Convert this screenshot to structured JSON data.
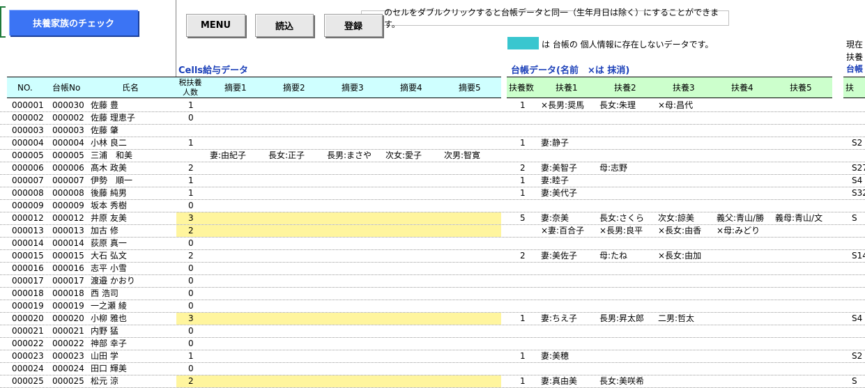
{
  "toolbar": {
    "check_label": "扶養家族のチェック",
    "menu_label": "MENU",
    "load_label": "読込",
    "register_label": "登録"
  },
  "note_text": "のセルをダブルクリックすると台帳データと同一（生年月日は除く）にすることができます。",
  "legend_text": "は 台帳の 個人情報に存在しないデータです。",
  "right_cut": {
    "line1": "現在",
    "line2": "扶養",
    "title": "台帳"
  },
  "sections": {
    "cells": "Cells給与データ",
    "ledger": "台帳データ(名前　×は 抹消)"
  },
  "headers": {
    "no": "NO.",
    "ledger_no": "台帳No",
    "name": "氏名",
    "tax_dep_1": "税扶養",
    "tax_dep_2": "人数",
    "summary": [
      "摘要1",
      "摘要2",
      "摘要3",
      "摘要4",
      "摘要5"
    ],
    "dep_count": "扶養数",
    "deps": [
      "扶養1",
      "扶養2",
      "扶養3",
      "扶養4",
      "扶養5"
    ],
    "right_cut": "扶"
  },
  "colors": {
    "cells_header": "#cfffff",
    "ledger_header": "#ccffcc",
    "highlight": "#fff59e",
    "legend": "#39c6cf",
    "title": "#1a3fb8",
    "button": "#3b74f4"
  },
  "rows": [
    {
      "no": "000001",
      "ledger": "000030",
      "name": "佐藤 豊",
      "tax": "1",
      "summary": [
        "",
        "",
        "",
        "",
        ""
      ],
      "dep_count": "1",
      "deps": [
        "×長男:奨馬",
        "長女:朱理",
        "×母:昌代",
        "",
        ""
      ],
      "right": "",
      "highlight": false
    },
    {
      "no": "000002",
      "ledger": "000002",
      "name": "佐藤 理恵子",
      "tax": "0",
      "summary": [
        "",
        "",
        "",
        "",
        ""
      ],
      "dep_count": "",
      "deps": [
        "",
        "",
        "",
        "",
        ""
      ],
      "right": "",
      "highlight": false
    },
    {
      "no": "000003",
      "ledger": "000003",
      "name": "佐藤 肇",
      "tax": "",
      "summary": [
        "",
        "",
        "",
        "",
        ""
      ],
      "dep_count": "",
      "deps": [
        "",
        "",
        "",
        "",
        ""
      ],
      "right": "",
      "highlight": false
    },
    {
      "no": "000004",
      "ledger": "000004",
      "name": "小林 良二",
      "tax": "1",
      "summary": [
        "",
        "",
        "",
        "",
        ""
      ],
      "dep_count": "1",
      "deps": [
        "妻:静子",
        "",
        "",
        "",
        ""
      ],
      "right": "S2",
      "highlight": false
    },
    {
      "no": "000005",
      "ledger": "000005",
      "name": "三浦　和美",
      "tax": "",
      "summary": [
        "妻:由紀子",
        "長女:正子",
        "長男:まさや",
        "次女:愛子",
        "次男:智寛"
      ],
      "dep_count": "",
      "deps": [
        "",
        "",
        "",
        "",
        ""
      ],
      "right": "",
      "highlight": false
    },
    {
      "no": "000006",
      "ledger": "000006",
      "name": "髙木 政美",
      "tax": "2",
      "summary": [
        "",
        "",
        "",
        "",
        ""
      ],
      "dep_count": "2",
      "deps": [
        "妻:美智子",
        "母:志野",
        "",
        "",
        ""
      ],
      "right": "S27",
      "highlight": false
    },
    {
      "no": "000007",
      "ledger": "000007",
      "name": "伊勢　順一",
      "tax": "1",
      "summary": [
        "",
        "",
        "",
        "",
        ""
      ],
      "dep_count": "1",
      "deps": [
        "妻:睦子",
        "",
        "",
        "",
        ""
      ],
      "right": "S4",
      "highlight": false
    },
    {
      "no": "000008",
      "ledger": "000008",
      "name": "後藤 純男",
      "tax": "1",
      "summary": [
        "",
        "",
        "",
        "",
        ""
      ],
      "dep_count": "1",
      "deps": [
        "妻:美代子",
        "",
        "",
        "",
        ""
      ],
      "right": "S32",
      "highlight": false
    },
    {
      "no": "000009",
      "ledger": "000009",
      "name": "坂本 秀樹",
      "tax": "0",
      "summary": [
        "",
        "",
        "",
        "",
        ""
      ],
      "dep_count": "",
      "deps": [
        "",
        "",
        "",
        "",
        ""
      ],
      "right": "",
      "highlight": false
    },
    {
      "no": "000012",
      "ledger": "000012",
      "name": "井原 友美",
      "tax": "3",
      "summary": [
        "",
        "",
        "",
        "",
        ""
      ],
      "dep_count": "5",
      "deps": [
        "妻:奈美",
        "長女:さくら",
        "次女:諒美",
        "義父:青山/勝",
        "義母:青山/文"
      ],
      "right": "S",
      "highlight": true
    },
    {
      "no": "000013",
      "ledger": "000013",
      "name": "加古 修",
      "tax": "2",
      "summary": [
        "",
        "",
        "",
        "",
        ""
      ],
      "dep_count": "",
      "deps": [
        "×妻:百合子",
        "×長男:良平",
        "×長女:由香",
        "×母:みどり",
        ""
      ],
      "right": "",
      "highlight": true
    },
    {
      "no": "000014",
      "ledger": "000014",
      "name": "荻原 真一",
      "tax": "0",
      "summary": [
        "",
        "",
        "",
        "",
        ""
      ],
      "dep_count": "",
      "deps": [
        "",
        "",
        "",
        "",
        ""
      ],
      "right": "",
      "highlight": false
    },
    {
      "no": "000015",
      "ledger": "000015",
      "name": "大石 弘文",
      "tax": "2",
      "summary": [
        "",
        "",
        "",
        "",
        ""
      ],
      "dep_count": "2",
      "deps": [
        "妻:美佐子",
        "母:たね",
        "×長女:由加",
        "",
        ""
      ],
      "right": "S14",
      "highlight": false
    },
    {
      "no": "000016",
      "ledger": "000016",
      "name": "志平 小雪",
      "tax": "0",
      "summary": [
        "",
        "",
        "",
        "",
        ""
      ],
      "dep_count": "",
      "deps": [
        "",
        "",
        "",
        "",
        ""
      ],
      "right": "",
      "highlight": false
    },
    {
      "no": "000017",
      "ledger": "000017",
      "name": "渡邉 かおり",
      "tax": "0",
      "summary": [
        "",
        "",
        "",
        "",
        ""
      ],
      "dep_count": "",
      "deps": [
        "",
        "",
        "",
        "",
        ""
      ],
      "right": "",
      "highlight": false
    },
    {
      "no": "000018",
      "ledger": "000018",
      "name": "西 浩司",
      "tax": "0",
      "summary": [
        "",
        "",
        "",
        "",
        ""
      ],
      "dep_count": "",
      "deps": [
        "",
        "",
        "",
        "",
        ""
      ],
      "right": "",
      "highlight": false
    },
    {
      "no": "000019",
      "ledger": "000019",
      "name": "一之瀬 綾",
      "tax": "0",
      "summary": [
        "",
        "",
        "",
        "",
        ""
      ],
      "dep_count": "",
      "deps": [
        "",
        "",
        "",
        "",
        ""
      ],
      "right": "",
      "highlight": false
    },
    {
      "no": "000020",
      "ledger": "000020",
      "name": "小柳 雅也",
      "tax": "3",
      "summary": [
        "",
        "",
        "",
        "",
        ""
      ],
      "dep_count": "1",
      "deps": [
        "妻:ちえ子",
        "長男:昇太郎",
        "二男:哲太",
        "",
        ""
      ],
      "right": "S4",
      "highlight": true
    },
    {
      "no": "000021",
      "ledger": "000021",
      "name": "内野 猛",
      "tax": "0",
      "summary": [
        "",
        "",
        "",
        "",
        ""
      ],
      "dep_count": "",
      "deps": [
        "",
        "",
        "",
        "",
        ""
      ],
      "right": "",
      "highlight": false
    },
    {
      "no": "000022",
      "ledger": "000022",
      "name": "神部 幸子",
      "tax": "0",
      "summary": [
        "",
        "",
        "",
        "",
        ""
      ],
      "dep_count": "",
      "deps": [
        "",
        "",
        "",
        "",
        ""
      ],
      "right": "",
      "highlight": false
    },
    {
      "no": "000023",
      "ledger": "000023",
      "name": "山田 学",
      "tax": "1",
      "summary": [
        "",
        "",
        "",
        "",
        ""
      ],
      "dep_count": "1",
      "deps": [
        "妻:美穂",
        "",
        "",
        "",
        ""
      ],
      "right": "S2",
      "highlight": false
    },
    {
      "no": "000024",
      "ledger": "000024",
      "name": "田口 輝美",
      "tax": "0",
      "summary": [
        "",
        "",
        "",
        "",
        ""
      ],
      "dep_count": "",
      "deps": [
        "",
        "",
        "",
        "",
        ""
      ],
      "right": "",
      "highlight": false
    },
    {
      "no": "000025",
      "ledger": "000025",
      "name": "松元 涼",
      "tax": "2",
      "summary": [
        "",
        "",
        "",
        "",
        ""
      ],
      "dep_count": "1",
      "deps": [
        "妻:真由美",
        "長女:美咲希",
        "",
        "",
        ""
      ],
      "right": "S",
      "highlight": true
    }
  ]
}
